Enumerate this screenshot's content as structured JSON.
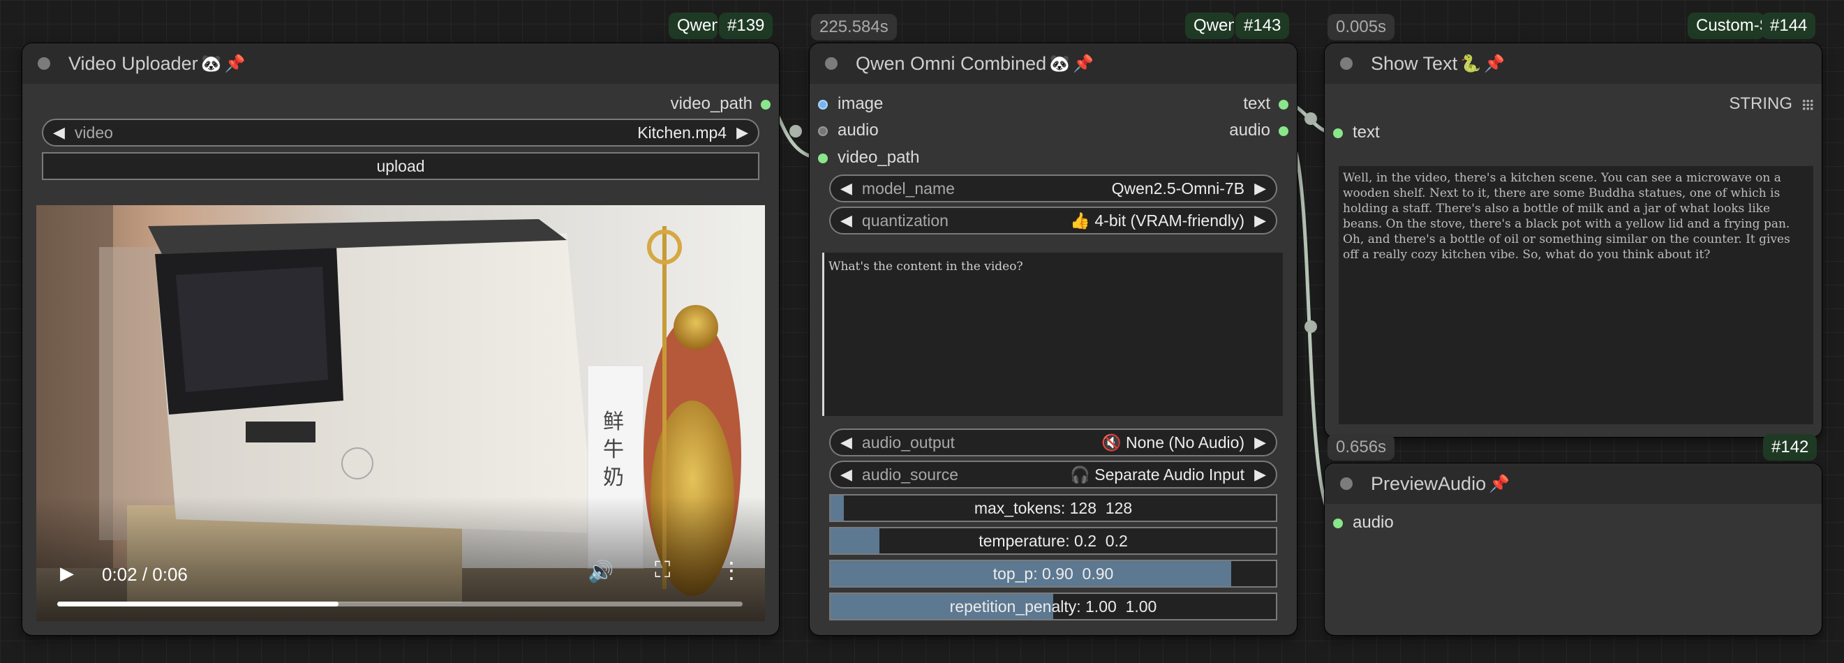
{
  "nodes": {
    "uploader": {
      "badge_name": "Qwen-",
      "badge_id": "#139",
      "title": "Video Uploader",
      "output_label": "video_path",
      "video_widget": {
        "label": "video",
        "value": "Kitchen.mp4"
      },
      "upload_label": "upload",
      "player": {
        "time": "0:02 / 0:06",
        "progress": 0.41
      }
    },
    "omni": {
      "time_badge": "225.584s",
      "badge_name": "Qwen-",
      "badge_id": "#143",
      "title": "Qwen Omni Combined",
      "inputs": [
        "image",
        "audio",
        "video_path"
      ],
      "outputs": [
        "text",
        "audio"
      ],
      "model_name": {
        "label": "model_name",
        "value": "Qwen2.5-Omni-7B"
      },
      "quantization": {
        "label": "quantization",
        "value": "👍 4-bit (VRAM-friendly)"
      },
      "prompt": "What's the content in the video?",
      "audio_output": {
        "label": "audio_output",
        "value": "🔇 None (No Audio)"
      },
      "audio_source": {
        "label": "audio_source",
        "value": "🎧 Separate Audio Input"
      },
      "max_tokens": {
        "text": "max_tokens: 128  128",
        "fraction": 0.03
      },
      "temperature": {
        "text": "temperature: 0.2  0.2",
        "fraction": 0.11
      },
      "top_p": {
        "text": "top_p: 0.90  0.90",
        "fraction": 0.9
      },
      "repetition_penalty": {
        "text": "repetition_penalty: 1.00  1.00",
        "fraction": 0.5
      }
    },
    "showtext": {
      "time_badge": "0.005s",
      "badge_name": "Custom-S",
      "badge_id": "#144",
      "title": "Show Text",
      "input_label": "text",
      "output_label": "STRING",
      "content": "Well, in the video, there's a kitchen scene. You can see a microwave on a wooden shelf. Next to it, there are some Buddha statues, one of which is holding a staff. There's also a bottle of milk and a jar of what looks like beans. On the stove, there's a black pot with a yellow lid and a frying pan. Oh, and there's a bottle of oil or something similar on the counter. It gives off a really cozy kitchen vibe. So, what do you think about it?"
    },
    "preview": {
      "time_badge": "0.656s",
      "badge_id": "#142",
      "title": "PreviewAudio",
      "input_label": "audio"
    }
  },
  "icons": {
    "panda": "🐼",
    "pin": "📌",
    "snake": "🐍"
  },
  "colors": {
    "slot_green": "#8ae68a",
    "slot_blue": "#78b4f0",
    "slider_fill": "#5d7891",
    "badge_bg": "#1f3a24"
  }
}
